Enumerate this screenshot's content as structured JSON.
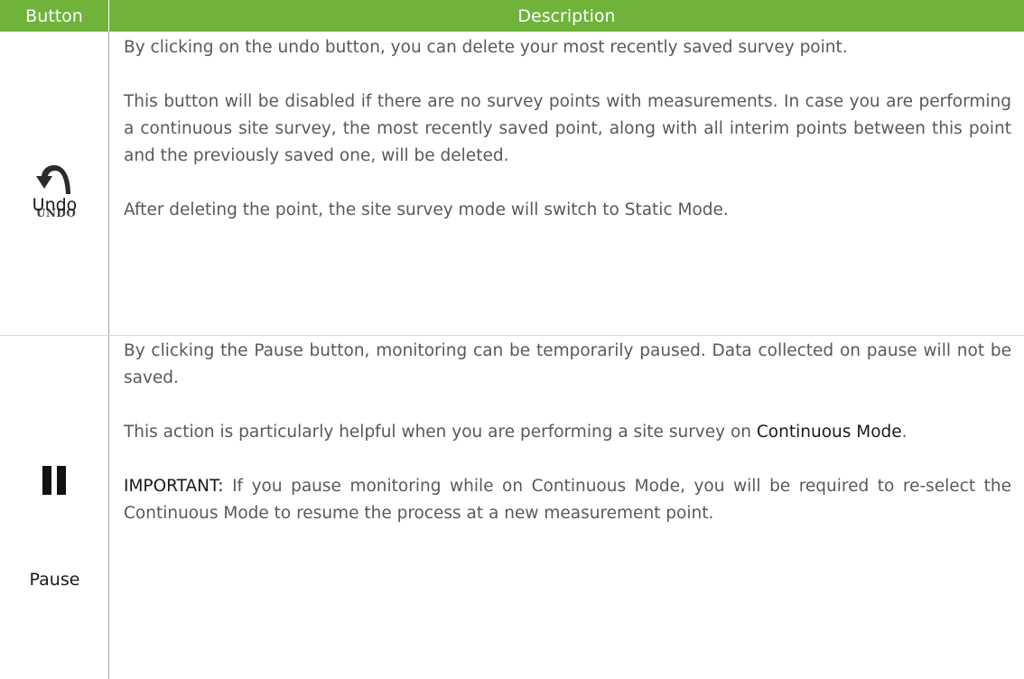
{
  "header": {
    "button_col": "Button",
    "description_col": "Description"
  },
  "rows": [
    {
      "label": "Undo",
      "icon": "undo-arrow-icon",
      "icon_text": "UNDO",
      "paragraphs": [
        "By clicking on the undo button, you can delete your most recently saved survey point.",
        "This button will be disabled if there are no survey points with measurements. In case you are performing a continuous site survey, the most recently saved point, along with all interim points between this point and the previously saved one, will be deleted.",
        "After deleting the point, the site survey mode will switch to Static Mode."
      ]
    },
    {
      "label": "Pause",
      "icon": "pause-icon",
      "paragraphs": [
        "By clicking the Pause button, monitoring can be temporarily paused. Data collected on pause will not be saved.",
        {
          "text": "This action is particularly helpful when you are performing a site survey on",
          "emphasis": "Continuous Mode",
          "end": "."
        },
        {
          "emphasis": "IMPORTANT:",
          "text": "If you pause monitoring while on Continuous Mode, you will be required to re-select the Continuous Mode to resume the process at a new measurement point."
        }
      ]
    }
  ],
  "colors": {
    "header_bg": "#6fb33b",
    "header_text": "#ffffff",
    "body_text": "#595959",
    "emphasis_text": "#1a1a1a"
  }
}
